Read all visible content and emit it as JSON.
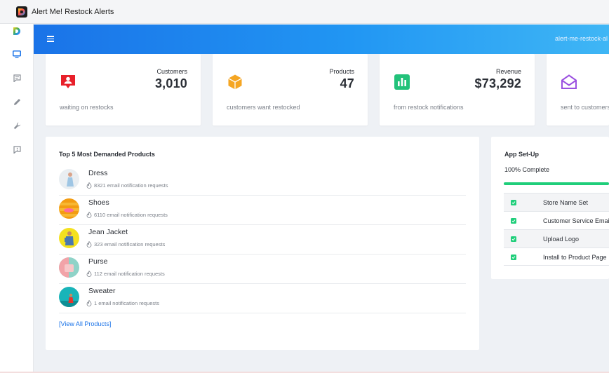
{
  "window": {
    "title": "Alert Me! Restock Alerts"
  },
  "header": {
    "store_name": "alert-me-restock-al"
  },
  "colors": {
    "accent": "#1a73e8",
    "success": "#1fce7a",
    "customers": "#e8202a",
    "products": "#f5a623",
    "revenue": "#22c27a",
    "sent": "#9b51e0"
  },
  "sidebar": {
    "items": [
      {
        "icon": "monitor-icon"
      },
      {
        "icon": "chat-icon"
      },
      {
        "icon": "pencil-icon"
      },
      {
        "icon": "wrench-icon"
      },
      {
        "icon": "feedback-icon"
      }
    ]
  },
  "stats": [
    {
      "label": "Customers",
      "value": "3,010",
      "sub": "waiting on restocks",
      "icon": "customer-alert-icon"
    },
    {
      "label": "Products",
      "value": "47",
      "sub": "customers want restocked",
      "icon": "box-icon"
    },
    {
      "label": "Revenue",
      "value": "$73,292",
      "sub": "from restock notifications",
      "icon": "bar-chart-icon"
    },
    {
      "label": "",
      "value": "",
      "sub": "sent to customers",
      "icon": "envelope-open-icon"
    }
  ],
  "products_panel": {
    "title": "Top 5 Most Demanded Products",
    "items": [
      {
        "name": "Dress",
        "requests": "8321 email notification requests"
      },
      {
        "name": "Shoes",
        "requests": "6110 email notification requests"
      },
      {
        "name": "Jean Jacket",
        "requests": "323 email notification requests"
      },
      {
        "name": "Purse",
        "requests": "112 email notification requests"
      },
      {
        "name": "Sweater",
        "requests": "1 email notification requests"
      }
    ],
    "view_all": "[View All Products]"
  },
  "setup_panel": {
    "title": "App Set-Up",
    "progress_text": "100% Complete",
    "progress_fraction": 1.0,
    "tasks": [
      {
        "label": "Store Name Set",
        "done": true
      },
      {
        "label": "Customer Service Email",
        "done": true
      },
      {
        "label": "Upload Logo",
        "done": true
      },
      {
        "label": "Install to Product Page",
        "done": true
      }
    ]
  }
}
